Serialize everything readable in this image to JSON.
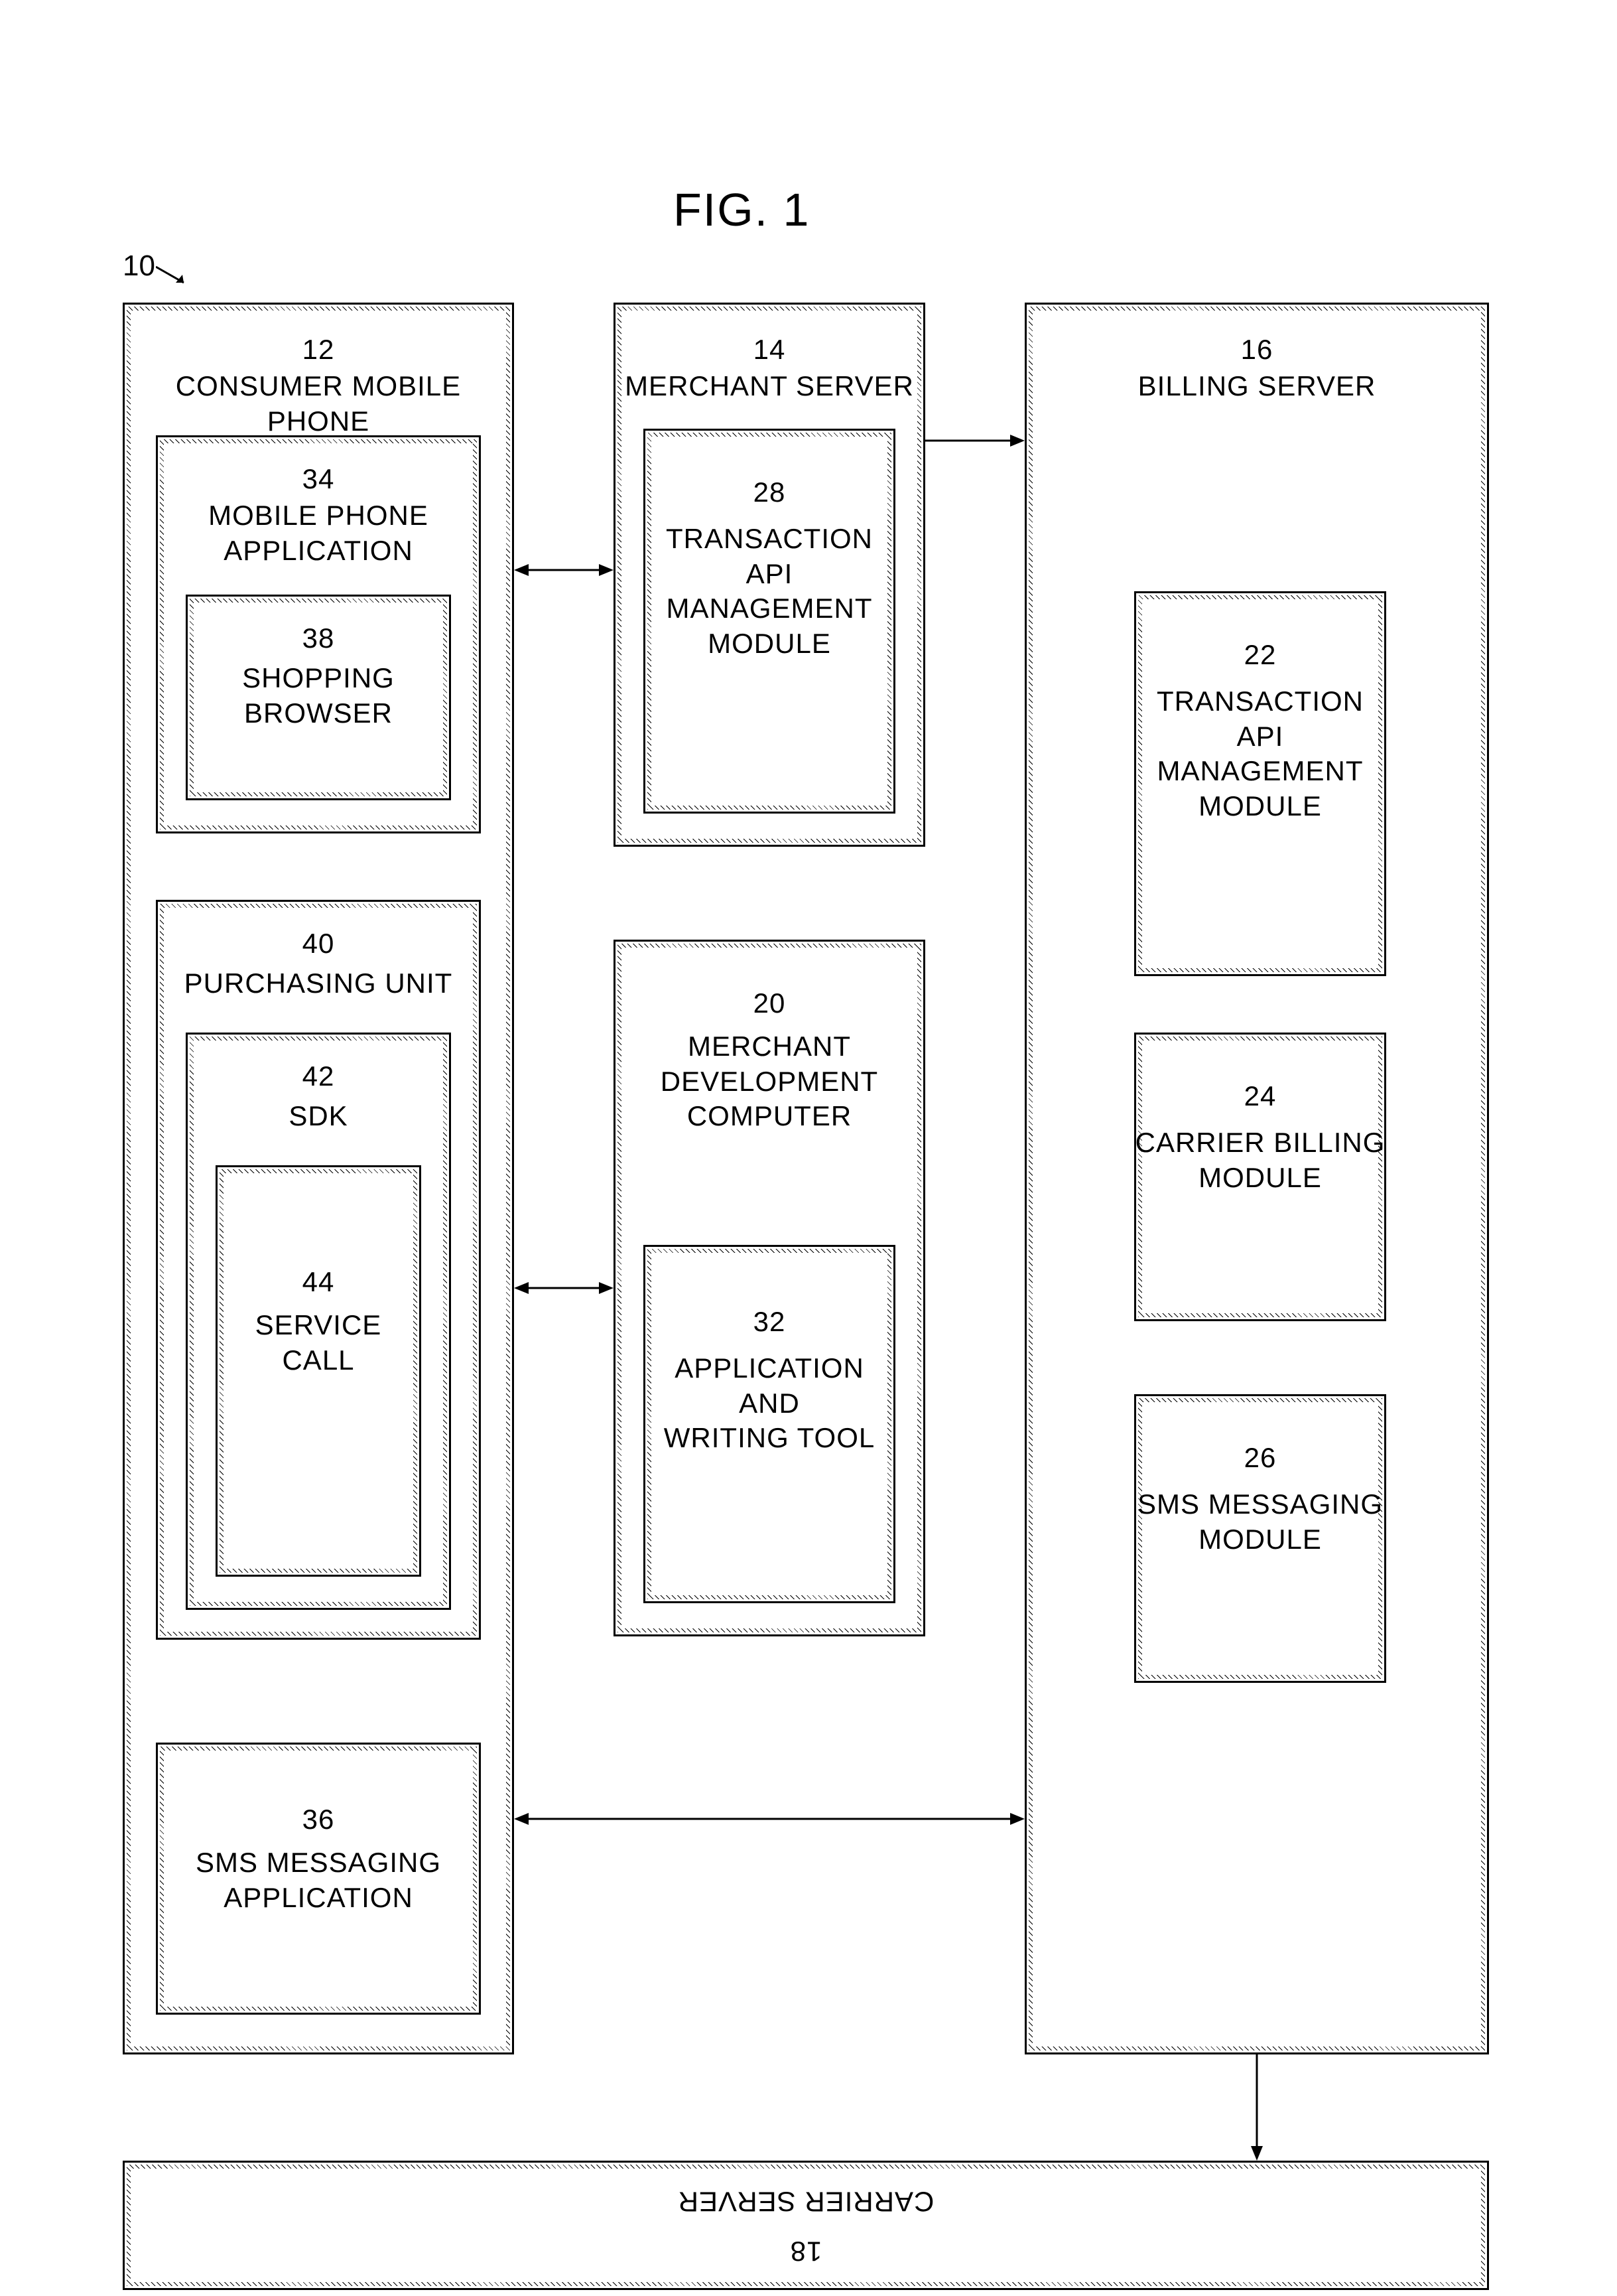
{
  "figure_title": "FIG. 1",
  "system_ref": "10",
  "consumer_mobile_phone": {
    "ref": "12",
    "label": "CONSUMER MOBILE PHONE"
  },
  "mobile_phone_application": {
    "ref": "34",
    "label": "MOBILE PHONE\nAPPLICATION"
  },
  "shopping_browser": {
    "ref": "38",
    "label": "SHOPPING\nBROWSER"
  },
  "purchasing_unit": {
    "ref": "40",
    "label": "PURCHASING UNIT"
  },
  "sdk": {
    "ref": "42",
    "label": "SDK"
  },
  "service_call": {
    "ref": "44",
    "label": "SERVICE\nCALL"
  },
  "sms_messaging_application": {
    "ref": "36",
    "label": "SMS MESSAGING\nAPPLICATION"
  },
  "merchant_server": {
    "ref": "14",
    "label": "MERCHANT SERVER"
  },
  "transaction_api_mgmt_28": {
    "ref": "28",
    "label": "TRANSACTION API\nMANAGEMENT\nMODULE"
  },
  "merchant_dev_computer": {
    "ref": "20",
    "label": "MERCHANT\nDEVELOPMENT\nCOMPUTER"
  },
  "application_writing_tool": {
    "ref": "32",
    "label": "APPLICATION AND\nWRITING TOOL"
  },
  "billing_server": {
    "ref": "16",
    "label": "BILLING SERVER"
  },
  "transaction_api_mgmt_22": {
    "ref": "22",
    "label": "TRANSACTION API\nMANAGEMENT\nMODULE"
  },
  "carrier_billing_module": {
    "ref": "24",
    "label": "CARRIER BILLING\nMODULE"
  },
  "sms_messaging_module": {
    "ref": "26",
    "label": "SMS MESSAGING\nMODULE"
  },
  "carrier_server": {
    "ref": "18",
    "label": "CARRIER SERVER"
  }
}
